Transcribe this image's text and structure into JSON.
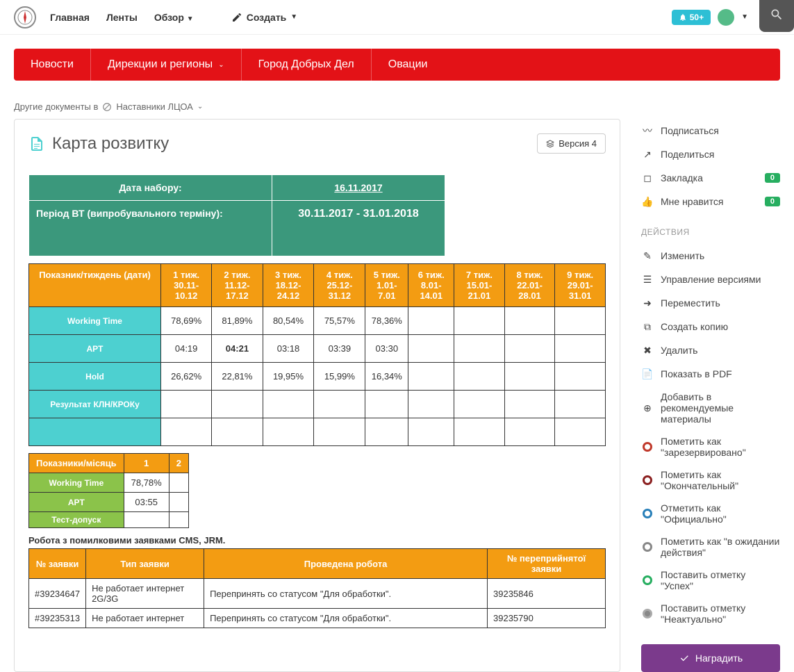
{
  "topnav": {
    "home": "Главная",
    "feeds": "Ленты",
    "overview": "Обзор",
    "create": "Создать",
    "notif_count": "50+"
  },
  "mainnav": {
    "news": "Новости",
    "directions": "Дирекции и регионы",
    "city": "Город Добрых Дел",
    "ovations": "Овации"
  },
  "breadcrumb": {
    "prefix": "Другие документы в",
    "location": "Наставники ЛЦОА"
  },
  "page": {
    "title": "Карта розвитку",
    "version_label": "Версия 4"
  },
  "meta": {
    "date_set_label": "Дата набору:",
    "date_set_value": "16.11.2017",
    "period_label": "Період ВТ (випробувального терміну):",
    "period_value": "30.11.2017 - 31.01.2018"
  },
  "weeks": {
    "header_metric": "Показник/тиждень (дати)",
    "cols": [
      {
        "w": "1 тиж.",
        "d": "30.11-10.12"
      },
      {
        "w": "2 тиж.",
        "d": "11.12-17.12"
      },
      {
        "w": "3 тиж.",
        "d": "18.12-24.12"
      },
      {
        "w": "4 тиж.",
        "d": "25.12-31.12"
      },
      {
        "w": "5 тиж.",
        "d": "1.01-7.01"
      },
      {
        "w": "6 тиж.",
        "d": "8.01-14.01"
      },
      {
        "w": "7 тиж.",
        "d": "15.01-21.01"
      },
      {
        "w": "8 тиж.",
        "d": "22.01-28.01"
      },
      {
        "w": "9 тиж.",
        "d": "29.01-31.01"
      }
    ],
    "rows": [
      {
        "label": "Working Time",
        "vals": [
          "78,69%",
          "81,89%",
          "80,54%",
          "75,57%",
          "78,36%",
          "",
          "",
          "",
          ""
        ]
      },
      {
        "label": "APT",
        "vals": [
          "04:19",
          "04:21",
          "03:18",
          "03:39",
          "03:30",
          "",
          "",
          "",
          ""
        ]
      },
      {
        "label": "Hold",
        "vals": [
          "26,62%",
          "22,81%",
          "19,95%",
          "15,99%",
          "16,34%",
          "",
          "",
          "",
          ""
        ]
      },
      {
        "label": "Результат КЛН/КРОКу",
        "vals": [
          "",
          "",
          "",
          "",
          "",
          "",
          "",
          "",
          ""
        ]
      },
      {
        "label": "",
        "vals": [
          "",
          "",
          "",
          "",
          "",
          "",
          "",
          "",
          ""
        ]
      }
    ]
  },
  "months": {
    "header_metric": "Показники/місяць",
    "cols": [
      "1",
      "2"
    ],
    "rows": [
      {
        "label": "Working Time",
        "vals": [
          "78,78%",
          ""
        ]
      },
      {
        "label": "APT",
        "vals": [
          "03:55",
          ""
        ]
      },
      {
        "label": "Тест-допуск",
        "vals": [
          "",
          ""
        ]
      }
    ]
  },
  "note": "Робота з помилковими заявками CMS, JRM.",
  "requests": {
    "headers": [
      "№ заявки",
      "Тип заявки",
      "Проведена робота",
      "№ переприйнятої заявки"
    ],
    "rows": [
      {
        "id": "#39234647",
        "type": "Не работает интернет 2G/3G",
        "work": "Перепринять со статусом \"Для обработки\".",
        "reassigned": "39235846"
      },
      {
        "id": "#39235313",
        "type": "Не работает интернет",
        "work": "Перепринять со статусом \"Для обработки\".",
        "reassigned": "39235790"
      }
    ]
  },
  "sidebar": {
    "subscribe": "Подписаться",
    "share": "Поделиться",
    "bookmark": "Закладка",
    "bookmark_count": "0",
    "like": "Мне нравится",
    "like_count": "0",
    "actions_title": "ДЕЙСТВИЯ",
    "edit": "Изменить",
    "versions": "Управление версиями",
    "move": "Переместить",
    "copy": "Создать копию",
    "delete": "Удалить",
    "pdf": "Показать в PDF",
    "recommend": "Добавить в рекомендуемые материалы",
    "mark_reserved": "Пометить как \"зарезервировано\"",
    "mark_final": "Пометить как \"Окончательный\"",
    "mark_official": "Отметить как \"Официально\"",
    "mark_pending": "Пометить как \"в ожидании действия\"",
    "mark_success": "Поставить отметку \"Успех\"",
    "mark_irrelevant": "Поставить отметку \"Неактуально\"",
    "award": "Наградить"
  }
}
